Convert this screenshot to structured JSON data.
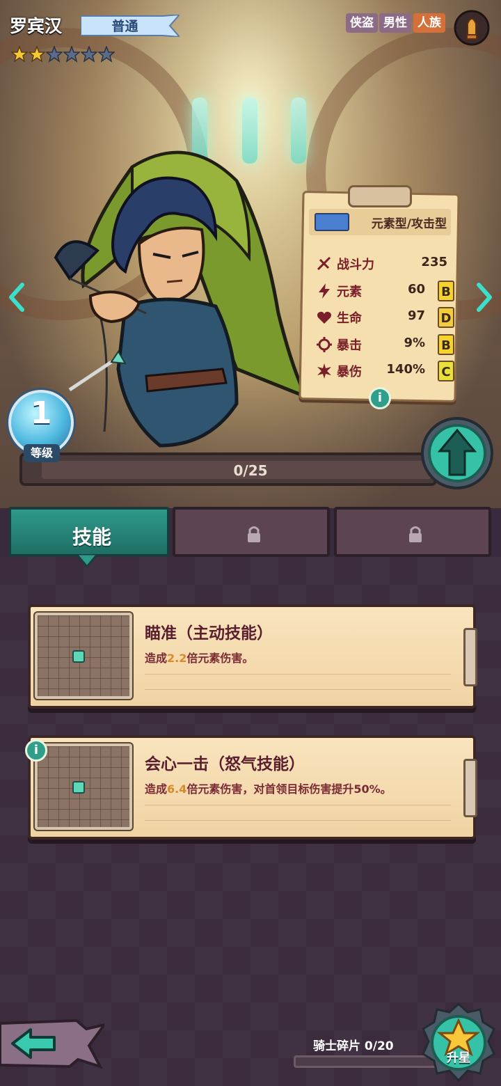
{
  "hero": {
    "name": "罗宾汉",
    "rarity": "普通",
    "stars_filled": 2,
    "stars_total": 6,
    "tags": [
      "侠盗",
      "男性",
      "人族"
    ],
    "level": "1",
    "level_label": "等级",
    "xp": "0/25"
  },
  "stats": {
    "type": "元素型/攻击型",
    "rows": [
      {
        "name": "战斗力",
        "value": "235",
        "grade": ""
      },
      {
        "name": "元素",
        "value": "60",
        "grade": "B"
      },
      {
        "name": "生命",
        "value": "97",
        "grade": "D"
      },
      {
        "name": "暴击",
        "value": "9%",
        "grade": "B"
      },
      {
        "name": "暴伤",
        "value": "140%",
        "grade": "C"
      }
    ],
    "info": "i"
  },
  "tabs": {
    "active": "技能"
  },
  "skills": [
    {
      "name": "瞄准（主动技能）",
      "desc_pre": "造成",
      "desc_hl": "2.2",
      "desc_post": "倍元素伤害。"
    },
    {
      "name": "会心一击（怒气技能）",
      "desc_pre": "造成",
      "desc_hl": "6.4",
      "desc_post": "倍元素伤害，对首领目标伤害提升50%。",
      "info": "i"
    }
  ],
  "footer": {
    "shards": "骑士碎片 0/20",
    "star_up": "升星"
  },
  "colors": {
    "accent_teal": "#2e9a8a",
    "grade_B": "#f5d22e",
    "grade_C": "#e9e03a",
    "grade_D": "#f2cc3a"
  },
  "icons": {
    "ammo": "bullet-icon",
    "prev": "chevron-left-icon",
    "next": "chevron-right-icon",
    "lock": "lock-icon",
    "upgrade": "arrow-up-icon",
    "back": "arrow-left-icon",
    "star_up": "star-icon"
  }
}
